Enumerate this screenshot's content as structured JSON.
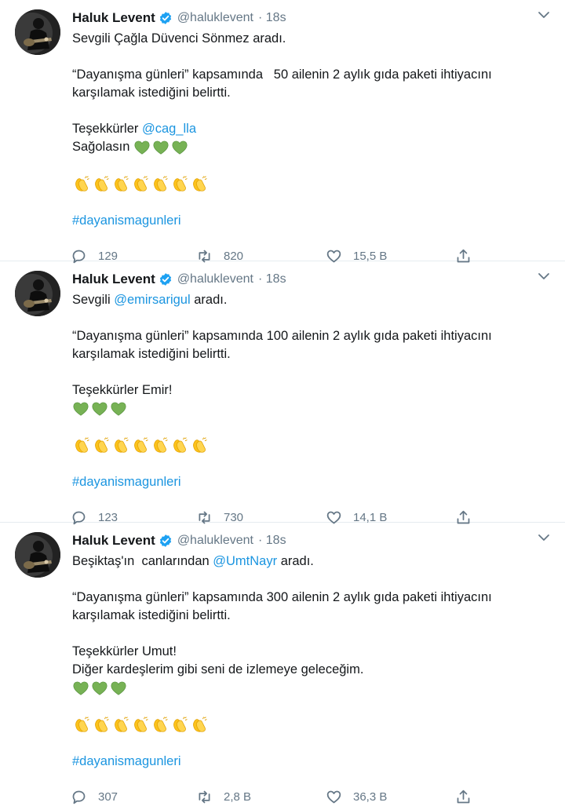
{
  "tweets": [
    {
      "author": "Haluk Levent",
      "handle": "@haluklevent",
      "time": "· 18s",
      "lines": [
        [
          {
            "t": "Sevgili Çağla Düvenci Sönmez aradı."
          }
        ],
        [],
        [
          {
            "t": "“Dayanışma günleri” kapsamında   50 ailenin 2 aylık gıda paketi ihtiyacını"
          }
        ],
        [
          {
            "t": "karşılamak istediğini belirtti."
          }
        ],
        [],
        [
          {
            "t": "Teşekkürler "
          },
          {
            "t": "@cag_lla",
            "link": true
          }
        ],
        [
          {
            "t": "Sağolasın "
          },
          {
            "hearts": 3
          }
        ],
        [],
        [
          {
            "claps": 7
          }
        ],
        [],
        [
          {
            "t": "#dayanismagunleri",
            "link": true
          }
        ]
      ],
      "replies": "129",
      "retweets": "820",
      "likes": "15,5 B"
    },
    {
      "author": "Haluk Levent",
      "handle": "@haluklevent",
      "time": "· 18s",
      "lines": [
        [
          {
            "t": "Sevgili "
          },
          {
            "t": "@emirsarigul",
            "link": true
          },
          {
            "t": " aradı."
          }
        ],
        [],
        [
          {
            "t": "“Dayanışma günleri” kapsamında 100 ailenin 2 aylık gıda paketi ihtiyacını"
          }
        ],
        [
          {
            "t": "karşılamak istediğini belirtti."
          }
        ],
        [],
        [
          {
            "t": "Teşekkürler Emir!"
          }
        ],
        [
          {
            "hearts": 3
          }
        ],
        [],
        [
          {
            "claps": 7
          }
        ],
        [],
        [
          {
            "t": "#dayanismagunleri",
            "link": true
          }
        ]
      ],
      "replies": "123",
      "retweets": "730",
      "likes": "14,1 B"
    },
    {
      "author": "Haluk Levent",
      "handle": "@haluklevent",
      "time": "· 18s",
      "lines": [
        [
          {
            "t": "Beşiktaş'ın  canlarından "
          },
          {
            "t": "@UmtNayr",
            "link": true
          },
          {
            "t": " aradı."
          }
        ],
        [],
        [
          {
            "t": "“Dayanışma günleri” kapsamında 300 ailenin 2 aylık gıda paketi ihtiyacını"
          }
        ],
        [
          {
            "t": "karşılamak istediğini belirtti."
          }
        ],
        [],
        [
          {
            "t": "Teşekkürler Umut!"
          }
        ],
        [
          {
            "t": "Diğer kardeşlerim gibi seni de izlemeye geleceğim."
          }
        ],
        [
          {
            "hearts": 3
          }
        ],
        [],
        [
          {
            "claps": 7
          }
        ],
        [],
        [
          {
            "t": "#dayanismagunleri",
            "link": true
          }
        ]
      ],
      "replies": "307",
      "retweets": "2,8 B",
      "likes": "36,3 B"
    }
  ],
  "colors": {
    "link": "#1b95e0",
    "verified": "#1da1f2",
    "heart_emoji": "#77b255",
    "clap_emoji": "#fcc21b",
    "meta": "#657786"
  },
  "icons": {
    "verified": "verified-badge-icon",
    "caret": "chevron-down-icon",
    "reply": "reply-icon",
    "retweet": "retweet-icon",
    "like": "heart-outline-icon",
    "share": "share-icon",
    "avatar": "guitarist-avatar"
  }
}
